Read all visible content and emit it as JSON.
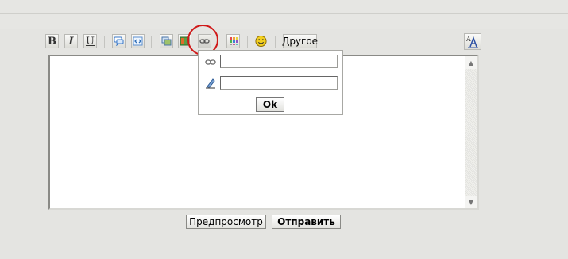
{
  "toolbar": {
    "bold_label": "B",
    "italic_label": "I",
    "underline_label": "U",
    "other_label": "Другое",
    "icons": {
      "quote": "speech-bubble-icon",
      "code": "code-arrows-icon",
      "image": "image-icon",
      "video": "video-icon",
      "link": "chain-link-icon",
      "color": "color-palette-icon",
      "smile": "smiley-icon",
      "font": "font-size-icon"
    }
  },
  "link_popup": {
    "url_value": "",
    "title_value": "",
    "ok_label": "Ok"
  },
  "editor": {
    "value": ""
  },
  "actions": {
    "preview_label": "Предпросмотр",
    "send_label": "Отправить"
  },
  "colors": {
    "background": "#e4e4e1",
    "highlight_circle": "#d01818",
    "smiley": "#f2cf1f"
  }
}
